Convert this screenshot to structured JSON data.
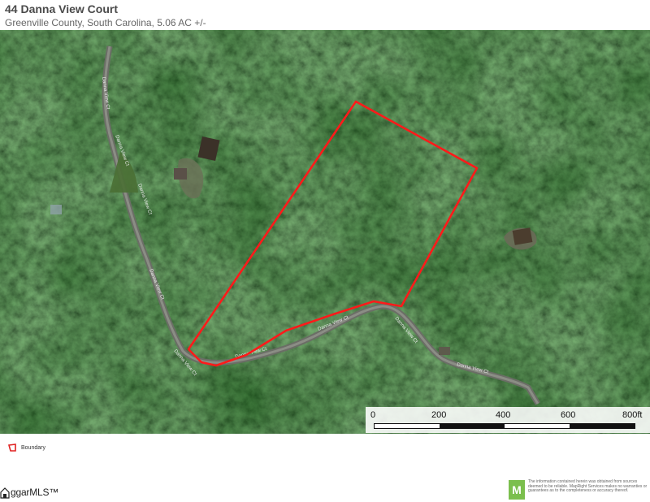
{
  "header": {
    "title": "44 Danna View Court",
    "subtitle": "Greenville County, South Carolina, 5.06 AC +/-"
  },
  "map": {
    "road_labels": [
      "Danna View Ct",
      "Danna View Ct",
      "Danna View Ct",
      "Danna View Ct",
      "Danna View Ct",
      "Danna View Ct",
      "Danna View Ct",
      "Danna View Ct",
      "Danna View Ct"
    ],
    "boundary_color": "#ff1a1a"
  },
  "scale": {
    "ticks": [
      "0",
      "200",
      "400",
      "600",
      "800ft"
    ]
  },
  "legend": {
    "boundary_label": "Boundary",
    "boundary_color": "#e02020"
  },
  "footer": {
    "brand_text": "ggarMLS™",
    "logo_letter": "M",
    "disclaimer": "The information contained herein was obtained from sources deemed to be reliable. MapRight Services makes no warranties or guarantees as to the completeness or accuracy thereof."
  }
}
